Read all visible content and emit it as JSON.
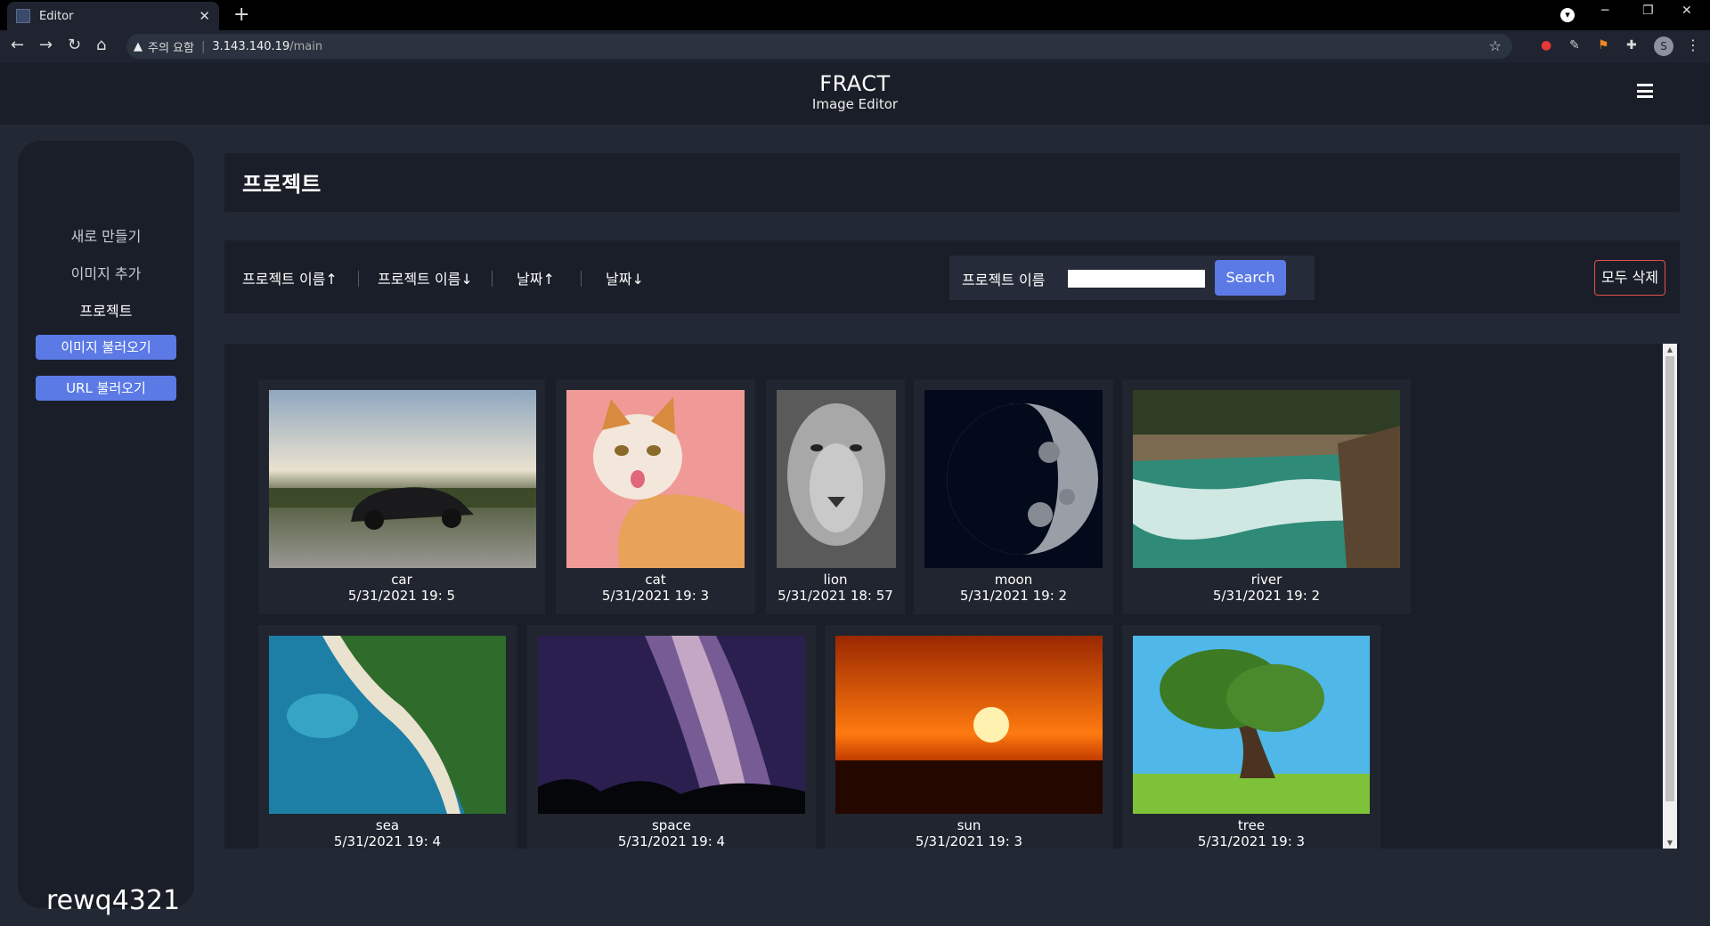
{
  "browser": {
    "tab_title": "Editor",
    "address_warning": "주의 요함",
    "address_host": "3.143.140.19",
    "address_path": "/main",
    "profile_initial": "S"
  },
  "header": {
    "title": "FRACT",
    "subtitle": "Image Editor"
  },
  "sidebar": {
    "links": [
      {
        "label": "새로 만들기"
      },
      {
        "label": "이미지 추가"
      },
      {
        "label": "프로젝트"
      }
    ],
    "buttons": [
      {
        "label": "이미지 불러오기"
      },
      {
        "label": "URL 불러오기"
      }
    ],
    "username": "rewq4321"
  },
  "page": {
    "title": "프로젝트"
  },
  "filters": {
    "sort": [
      "프로젝트 이름↑",
      "프로젝트 이름↓",
      "날짜↑",
      "날짜↓"
    ],
    "search_label": "프로젝트 이름",
    "search_value": "",
    "search_button": "Search",
    "delete_all": "모두 삭제"
  },
  "projects": [
    {
      "name": "car",
      "date": "5/31/2021 19: 5"
    },
    {
      "name": "cat",
      "date": "5/31/2021 19: 3"
    },
    {
      "name": "lion",
      "date": "5/31/2021 18: 57"
    },
    {
      "name": "moon",
      "date": "5/31/2021 19: 2"
    },
    {
      "name": "river",
      "date": "5/31/2021 19: 2"
    },
    {
      "name": "sea",
      "date": "5/31/2021 19: 4"
    },
    {
      "name": "space",
      "date": "5/31/2021 19: 4"
    },
    {
      "name": "sun",
      "date": "5/31/2021 19: 3"
    },
    {
      "name": "tree",
      "date": "5/31/2021 19: 3"
    }
  ],
  "colors": {
    "accent": "#5b7ae6",
    "danger": "#e0524e",
    "panel": "#1a1e28",
    "background": "#222834"
  }
}
